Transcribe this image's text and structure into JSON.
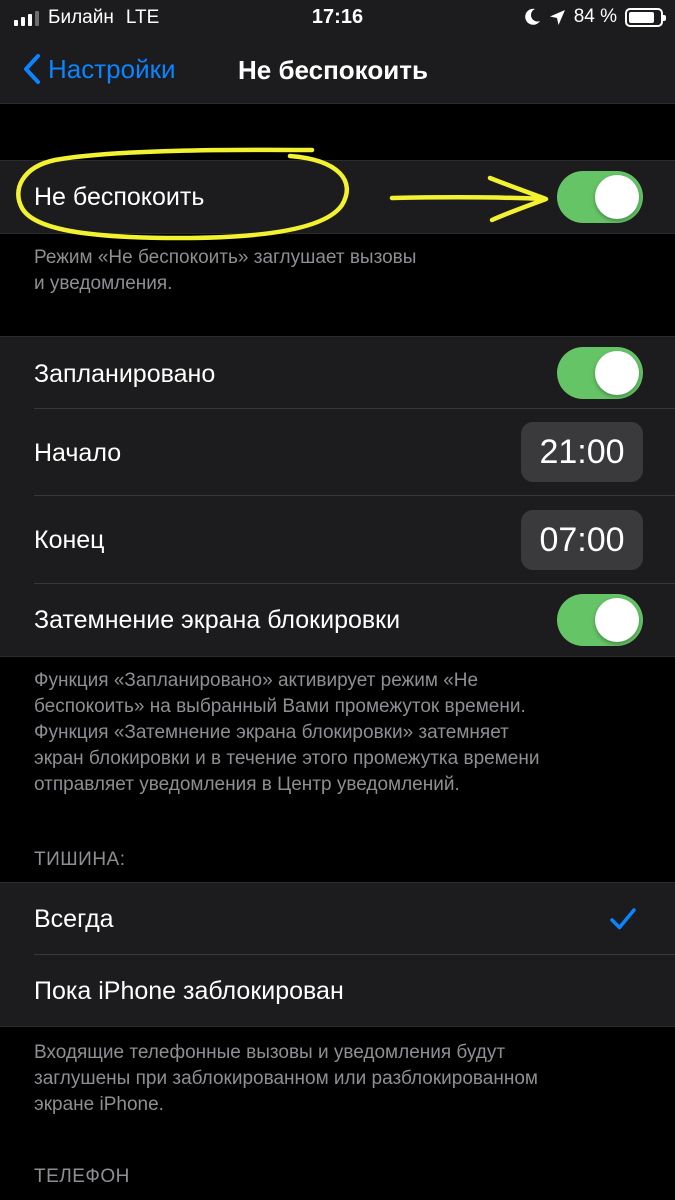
{
  "status_bar": {
    "carrier": "Билайн",
    "network": "LTE",
    "time": "17:16",
    "battery_percent": "84 %",
    "battery_level": 0.84,
    "signal_bars_active": 3,
    "signal_bars_total": 4
  },
  "nav": {
    "back_label": "Настройки",
    "title": "Не беспокоить"
  },
  "dnd": {
    "label": "Не беспокоить",
    "enabled": true,
    "footer_line1": "Режим «Не беспокоить» заглушает вызовы",
    "footer_line2": "и уведомления."
  },
  "schedule": {
    "scheduled_label": "Запланировано",
    "scheduled_enabled": true,
    "start_label": "Начало",
    "start_time": "21:00",
    "end_label": "Конец",
    "end_time": "07:00",
    "dim_label": "Затемнение экрана блокировки",
    "dim_enabled": true,
    "footer_lines": [
      "Функция «Запланировано» активирует режим «Не",
      "беспокоить» на выбранный Вами промежуток времени.",
      "Функция «Затемнение экрана блокировки» затемняет",
      "экран блокировки и в течение этого промежутка времени",
      "отправляет уведомления в Центр уведомлений."
    ]
  },
  "silence": {
    "header": "ТИШИНА:",
    "option_always": "Всегда",
    "option_locked": "Пока iPhone заблокирован",
    "selected": "always",
    "footer_lines": [
      "Входящие телефонные вызовы и уведомления будут",
      "заглушены при заблокированном или разблокированном",
      "экране iPhone."
    ]
  },
  "phone": {
    "header": "ТЕЛЕФОН"
  },
  "colors": {
    "accent_blue": "#0a84ff",
    "toggle_green": "#65c466",
    "annotation_yellow": "#f2f230",
    "cell_background": "#1c1c1e",
    "page_background": "#000000"
  },
  "icons": {
    "back": "chevron-left-icon",
    "selected_check": "checkmark-icon",
    "location": "location-arrow-icon",
    "moon": "moon-icon"
  }
}
